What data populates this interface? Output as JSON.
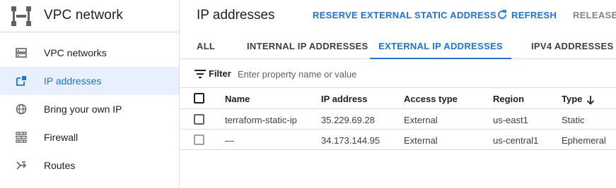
{
  "sidebar": {
    "title": "VPC network",
    "items": [
      {
        "label": "VPC networks",
        "icon": "vpc-networks-icon",
        "active": false
      },
      {
        "label": "IP addresses",
        "icon": "ip-addresses-icon",
        "active": true
      },
      {
        "label": "Bring your own IP",
        "icon": "globe-icon",
        "active": false
      },
      {
        "label": "Firewall",
        "icon": "firewall-icon",
        "active": false
      },
      {
        "label": "Routes",
        "icon": "routes-icon",
        "active": false
      }
    ]
  },
  "header": {
    "title": "IP addresses",
    "reserve_label": "RESERVE EXTERNAL STATIC ADDRESS",
    "refresh_label": "REFRESH",
    "release_label": "RELEASE S"
  },
  "tabs": [
    {
      "label": "ALL",
      "active": false
    },
    {
      "label": "INTERNAL IP ADDRESSES",
      "active": false
    },
    {
      "label": "EXTERNAL IP ADDRESSES",
      "active": true
    },
    {
      "label": "IPV4 ADDRESSES",
      "active": false
    }
  ],
  "filter": {
    "label": "Filter",
    "placeholder": "Enter property name or value"
  },
  "table": {
    "columns": [
      "Name",
      "IP address",
      "Access type",
      "Region",
      "Type"
    ],
    "sorted_column": "Type",
    "rows": [
      [
        "terraform-static-ip",
        "35.229.69.28",
        "External",
        "us-east1",
        "Static"
      ],
      [
        "—",
        "34.173.144.95",
        "External",
        "us-central1",
        "Ephemeral"
      ]
    ]
  },
  "colors": {
    "accent": "#1a73e8",
    "active_bg": "#e8f0fe",
    "divider": "#dadce0"
  }
}
